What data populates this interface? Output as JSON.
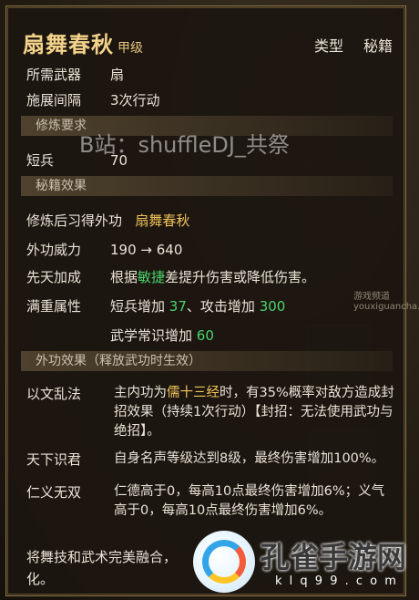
{
  "header": {
    "title": "扇舞春秋",
    "grade": "甲级",
    "type_label": "类型",
    "type_value": "秘籍"
  },
  "basic": [
    {
      "label": "所需武器",
      "value": "扇"
    },
    {
      "label": "施展间隔",
      "value": "3次行动"
    }
  ],
  "section_practice": "修炼要求",
  "practice_req": {
    "label": "短兵",
    "value": "70"
  },
  "watermark": "B站：shuffleDJ_共祭",
  "section_effect": "秘籍效果",
  "learn": {
    "label": "修炼后习得外功",
    "value": "扇舞春秋"
  },
  "power": {
    "label": "外功威力",
    "value": "190 → 640"
  },
  "innate": {
    "label": "先天加成",
    "pre": "根据",
    "stat": "敏捷",
    "post": "差提升伤害或降低伤害。"
  },
  "full": {
    "label": "满重属性",
    "line1_a": "短兵增加",
    "line1_a_val": "37",
    "line1_b": "、攻击增加",
    "line1_b_val": "300",
    "line2_a": "武学常识增加",
    "line2_a_val": "60"
  },
  "section_skill": "外功效果（释放武功时生效）",
  "skill1": {
    "label": "以文乱法",
    "text_a": "主内功为",
    "highlight": "儒十三经",
    "text_b": "时，有35%概率对敌方造成封招效果（持续1次行动）【封招：无法使用武功与绝招】。"
  },
  "skill2": {
    "label": "天下识君",
    "text": "自身名声等级达到8级，最终伤害增加100%。"
  },
  "skill3": {
    "label": "仁义无双",
    "text": "仁德高于0，每高10点最终伤害增加6%；义气高于0，每高10点最终伤害增加6%。"
  },
  "footer": "将舞技和武术完美融合，化。",
  "logo": {
    "name": "孔雀手游网",
    "url": "k l q 9 9 . c o m"
  },
  "side_watermark": "游戏频道 youxiguancha.com",
  "colors": {
    "title": "#f3d28a",
    "highlight": "#f0c35a",
    "bonus": "#49d46a"
  }
}
